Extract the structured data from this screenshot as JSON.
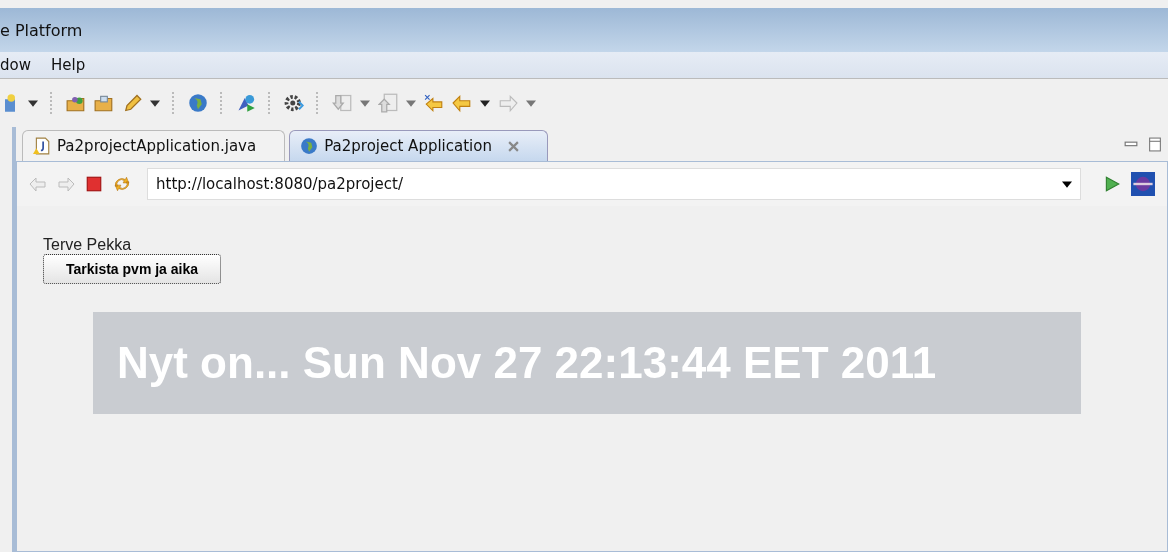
{
  "window": {
    "title": "e Platform"
  },
  "menu": [
    "dow",
    "Help"
  ],
  "tabs": [
    {
      "label": "Pa2projectApplication.java",
      "selected": false,
      "kind": "java"
    },
    {
      "label": "Pa2project Application",
      "selected": true,
      "kind": "browser",
      "closable": true
    }
  ],
  "browser": {
    "url": "http://localhost:8080/pa2project/"
  },
  "page": {
    "greeting": "Terve Pekka",
    "button": "Tarkista pvm ja aika",
    "message": "Nyt on... Sun Nov 27 22:13:44 EET 2011"
  }
}
